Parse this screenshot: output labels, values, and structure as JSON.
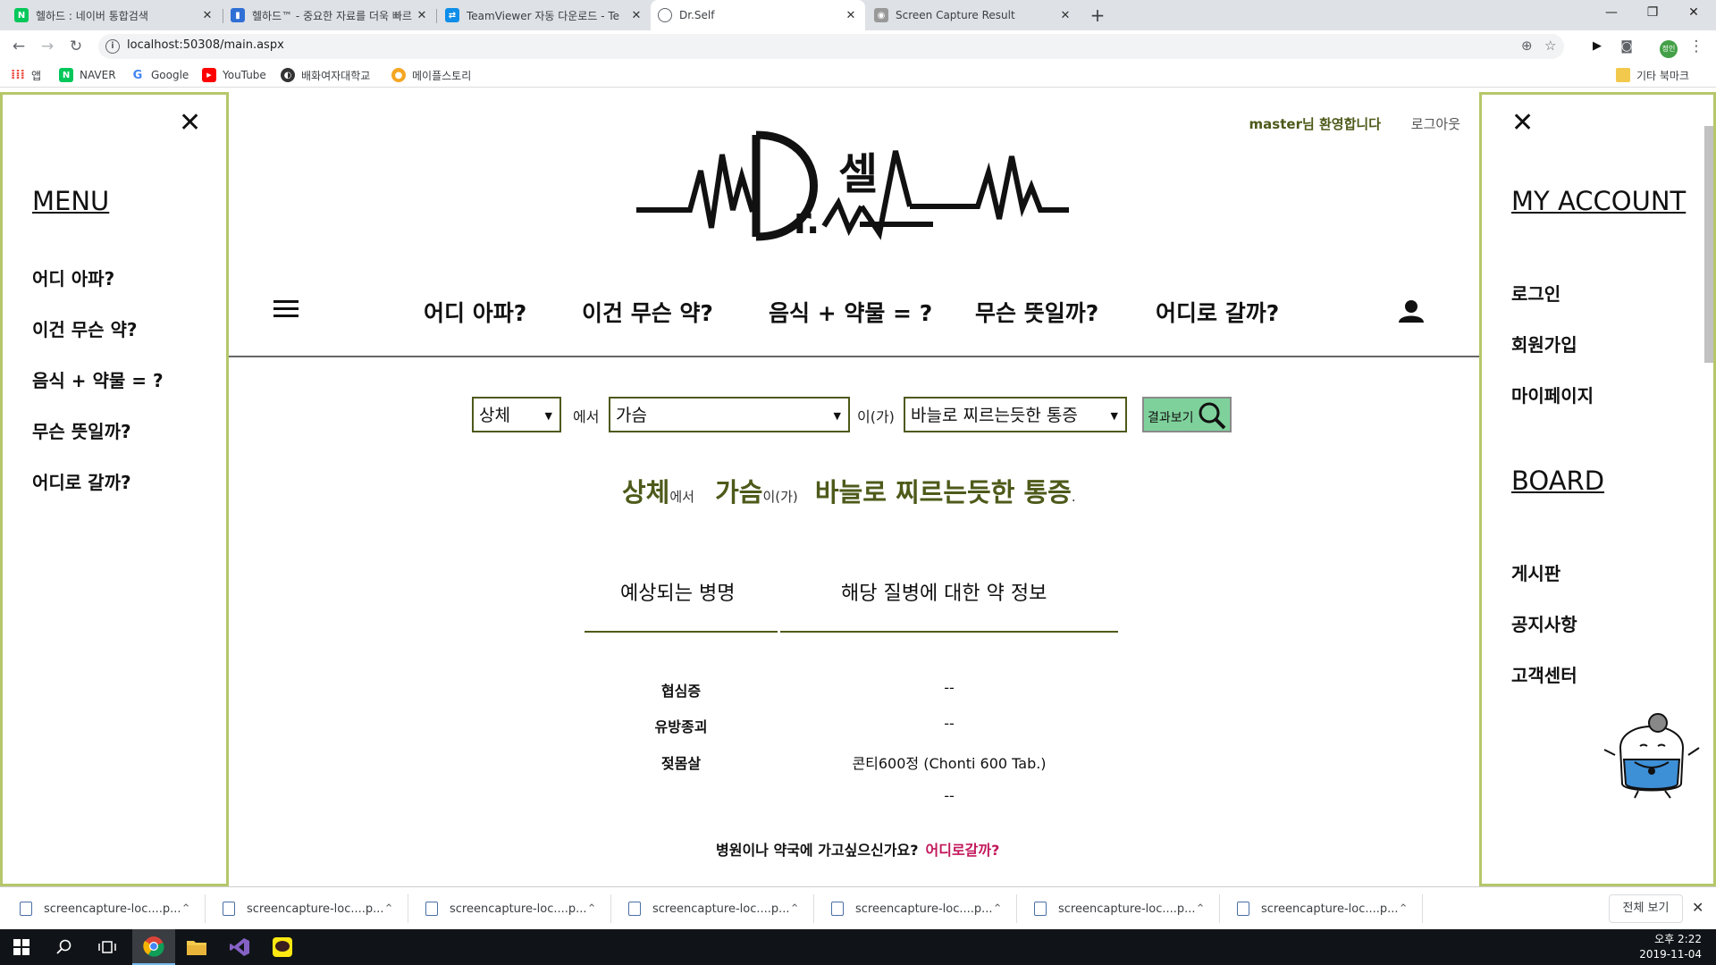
{
  "browser": {
    "tabs": [
      {
        "title": "헬하드 : 네이버 통합검색",
        "favicon": "naver-icon",
        "color": "#03c75a"
      },
      {
        "title": "헬하드™ - 중요한 자료를 더욱 빠르",
        "favicon": "chart-icon",
        "color": "#2f6fd6"
      },
      {
        "title": "TeamViewer 자동 다운로드 - Te",
        "favicon": "teamviewer-icon",
        "color": "#0e8ee9"
      },
      {
        "title": "Dr.Self",
        "favicon": "globe-icon",
        "color": "#5f6368"
      },
      {
        "title": "Screen Capture Result",
        "favicon": "camera-icon",
        "color": "#777777"
      }
    ],
    "url": "localhost:50308/main.aspx",
    "bookmarks": [
      {
        "label": "앱",
        "icon": "apps-icon"
      },
      {
        "label": "NAVER",
        "icon": "naver-icon"
      },
      {
        "label": "Google",
        "icon": "google-icon"
      },
      {
        "label": "YouTube",
        "icon": "youtube-icon"
      },
      {
        "label": "배화여자대학교",
        "icon": "school-icon"
      },
      {
        "label": "메이플스토리",
        "icon": "maple-icon"
      }
    ],
    "other_bookmarks": "기타 북마크",
    "profile_label": "정인"
  },
  "left_menu": {
    "heading": "MENU",
    "items": [
      "어디 아파?",
      "이건 무슨 약?",
      "음식 + 약물 = ?",
      "무슨 뜻일까?",
      "어디로 갈까?"
    ]
  },
  "right_menu": {
    "account_heading": "MY ACCOUNT",
    "account_items": [
      "로그인",
      "회원가입",
      "마이페이지"
    ],
    "board_heading": "BOARD",
    "board_items": [
      "게시판",
      "공지사항",
      "고객센터"
    ]
  },
  "header": {
    "greeting": "master님 환영합니다",
    "logout": "로그아웃",
    "nav": [
      "어디 아파?",
      "이건 무슨 약?",
      "음식 + 약물 = ?",
      "무슨 뜻일까?",
      "어디로 갈까?"
    ]
  },
  "search": {
    "body_part": "상체",
    "connector1": "에서",
    "location": "가슴",
    "connector2": "이(가)",
    "symptom": "바늘로 찌르는듯한 통증",
    "button": "결과보기"
  },
  "summary": {
    "part": "상체",
    "part_suffix": "에서",
    "location": "가슴",
    "location_suffix": "이(가)",
    "symptom": "바늘로 찌르는듯한 통증",
    "end": "."
  },
  "results": {
    "col1": "예상되는 병명",
    "col2": "해당 질병에 대한 약 정보",
    "rows": [
      {
        "disease": "협심증",
        "drug": "--"
      },
      {
        "disease": "유방종괴",
        "drug": "--"
      },
      {
        "disease": "젖몸살",
        "drug": "콘티600정 (Chonti 600 Tab.)"
      },
      {
        "disease": "",
        "drug": "--"
      }
    ],
    "hospital_question": "병원이나 약국에 가고싶으신가요?",
    "hospital_link": "어디로갈까?"
  },
  "downloads": {
    "items": [
      "screencapture-loc....p...",
      "screencapture-loc....p...",
      "screencapture-loc....p...",
      "screencapture-loc....p...",
      "screencapture-loc....p...",
      "screencapture-loc....p...",
      "screencapture-loc....p..."
    ],
    "show_all": "전체 보기"
  },
  "taskbar": {
    "time": "오후 2:22",
    "date": "2019-11-04"
  },
  "colors": {
    "accent_olive": "#4d5a1a",
    "sidebar_border": "#b5c76a",
    "result_button": "#7fd19b",
    "link_red": "#c2185b"
  }
}
